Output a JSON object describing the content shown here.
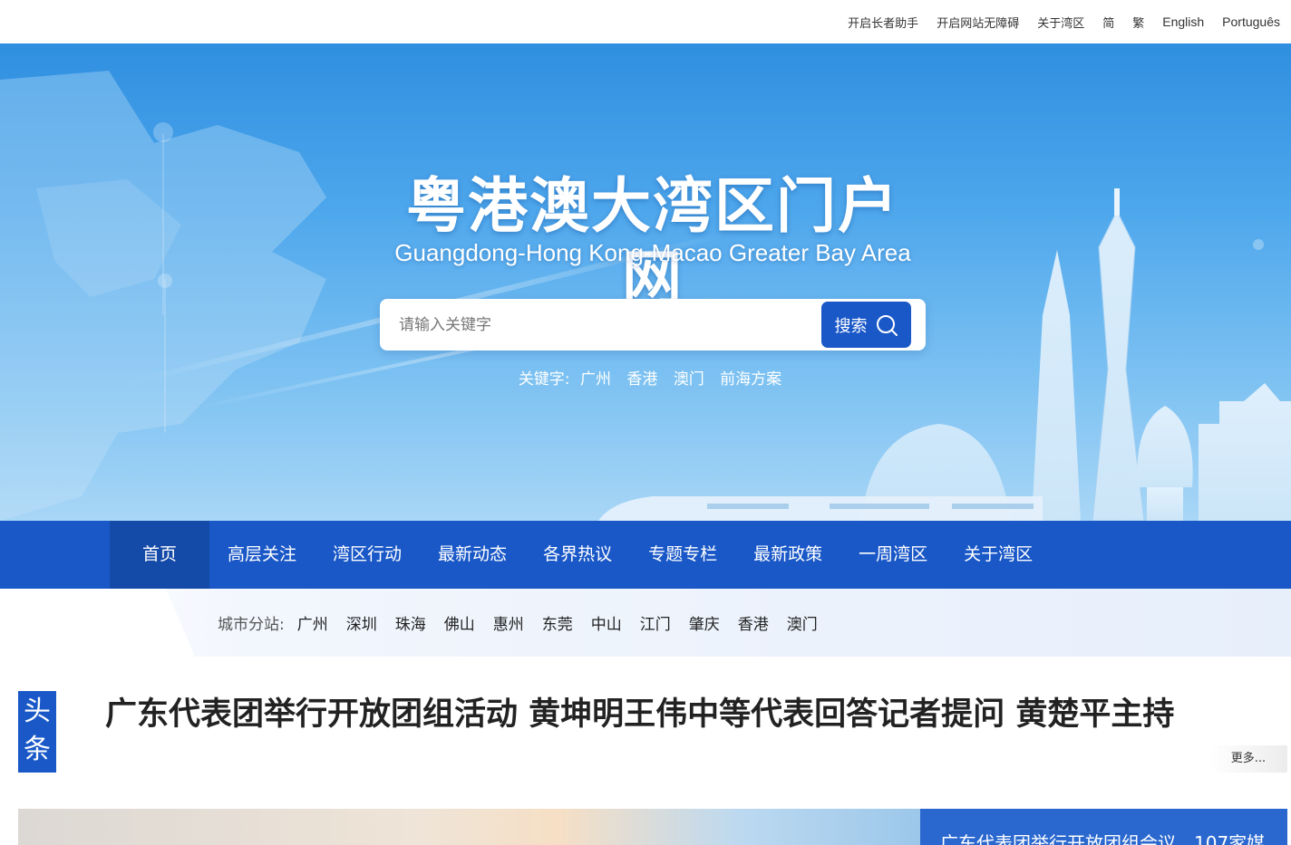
{
  "topbar": {
    "links": [
      "开启长者助手",
      "开启网站无障碍",
      "关于湾区",
      "简",
      "繁",
      "English",
      "Português"
    ]
  },
  "banner": {
    "title": "粤港澳大湾区门户网",
    "subtitle": "Guangdong-Hong Kong-Macao Greater Bay Area"
  },
  "search": {
    "placeholder": "请输入关键字",
    "button_label": "搜索",
    "button_icon": "search-icon"
  },
  "keywords": {
    "label": "关键字:",
    "items": [
      "广州",
      "香港",
      "澳门",
      "前海方案"
    ]
  },
  "nav": {
    "items": [
      "首页",
      "高层关注",
      "湾区行动",
      "最新动态",
      "各界热议",
      "专题专栏",
      "最新政策",
      "一周湾区",
      "关于湾区"
    ],
    "active": "首页"
  },
  "cities": {
    "label": "城市分站:",
    "items": [
      "广州",
      "深圳",
      "珠海",
      "佛山",
      "惠州",
      "东莞",
      "中山",
      "江门",
      "肇庆",
      "香港",
      "澳门"
    ]
  },
  "headline": {
    "tag": "头条",
    "text": "广东代表团举行开放团组活动 黄坤明王伟中等代表回答记者提问 黄楚平主持",
    "more_label": "更多..."
  },
  "feature": {
    "caption": "广东代表团举行开放团组会议，107家媒"
  },
  "colors": {
    "brand_blue": "#1a58c8",
    "nav_active": "#144aa8"
  }
}
